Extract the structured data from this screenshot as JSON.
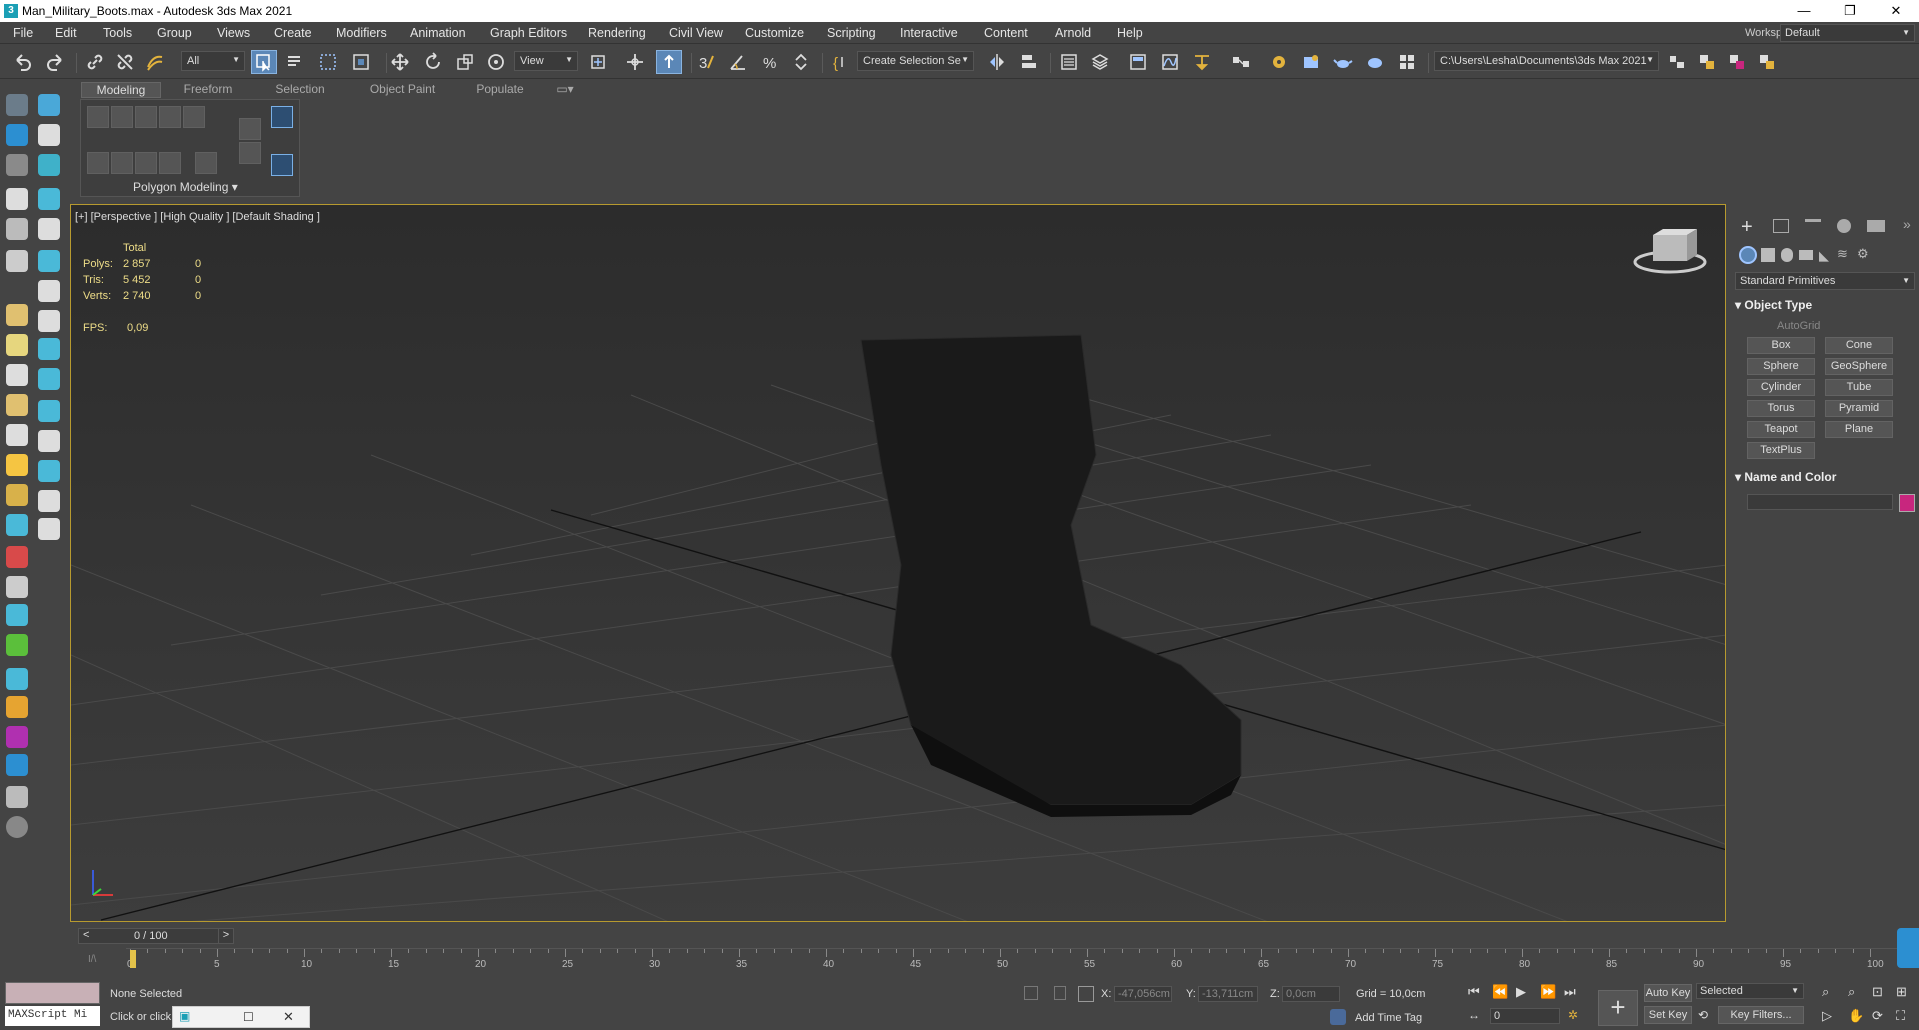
{
  "window": {
    "title": "Man_Military_Boots.max - Autodesk 3ds Max 2021",
    "app_badge": "3",
    "minimize": "—",
    "maximize": "❐",
    "close": "✕"
  },
  "menu": [
    "File",
    "Edit",
    "Tools",
    "Group",
    "Views",
    "Create",
    "Modifiers",
    "Animation",
    "Graph Editors",
    "Rendering",
    "Civil View",
    "Customize",
    "Scripting",
    "Interactive",
    "Content",
    "Arnold",
    "Help"
  ],
  "workspaces": {
    "label": "Workspaces:",
    "value": "Default"
  },
  "toolbar": {
    "selection_filter": "All",
    "ref_coord": "View",
    "named_selection": "Create Selection Se",
    "project_path": "C:\\Users\\Lesha\\Documents\\3ds Max 2021"
  },
  "ribbon": {
    "tabs": [
      "Modeling",
      "Freeform",
      "Selection",
      "Object Paint",
      "Populate"
    ],
    "panel_title": "Polygon Modeling"
  },
  "viewport": {
    "label": "[+] [Perspective ] [High Quality ] [Default Shading ]",
    "stats": {
      "header": "Total",
      "polys_label": "Polys:",
      "polys": "2 857",
      "polys_sel": "0",
      "tris_label": "Tris:",
      "tris": "5 452",
      "tris_sel": "0",
      "verts_label": "Verts:",
      "verts": "2 740",
      "verts_sel": "0",
      "fps_label": "FPS:",
      "fps": "0,09"
    }
  },
  "command_panel": {
    "dropdown": "Standard Primitives",
    "object_type_title": "Object Type",
    "autogrid": "AutoGrid",
    "buttons": [
      "Box",
      "Cone",
      "Sphere",
      "GeoSphere",
      "Cylinder",
      "Tube",
      "Torus",
      "Pyramid",
      "Teapot",
      "Plane",
      "TextPlus"
    ],
    "name_color_title": "Name and Color",
    "color": "#c8267e"
  },
  "timeline": {
    "frame": "0 / 100",
    "prev": "<",
    "next": ">",
    "ticks": [
      "0",
      "5",
      "10",
      "15",
      "20",
      "25",
      "30",
      "35",
      "40",
      "45",
      "50",
      "55",
      "60",
      "65",
      "70",
      "75",
      "80",
      "85",
      "90",
      "95",
      "100"
    ]
  },
  "status": {
    "maxscript": "MAXScript Mi",
    "selection": "None Selected",
    "prompt": "Click or click",
    "x_label": "X:",
    "x": "-47,056cm",
    "y_label": "Y:",
    "y": "-13,711cm",
    "z_label": "Z:",
    "z": "0,0cm",
    "grid": "Grid = 10,0cm",
    "time_tag": "Add Time Tag",
    "auto_key": "Auto Key",
    "set_key": "Set Key",
    "key_mode": "Selected",
    "key_filters": "Key Filters...",
    "frame_spinner": "0"
  }
}
